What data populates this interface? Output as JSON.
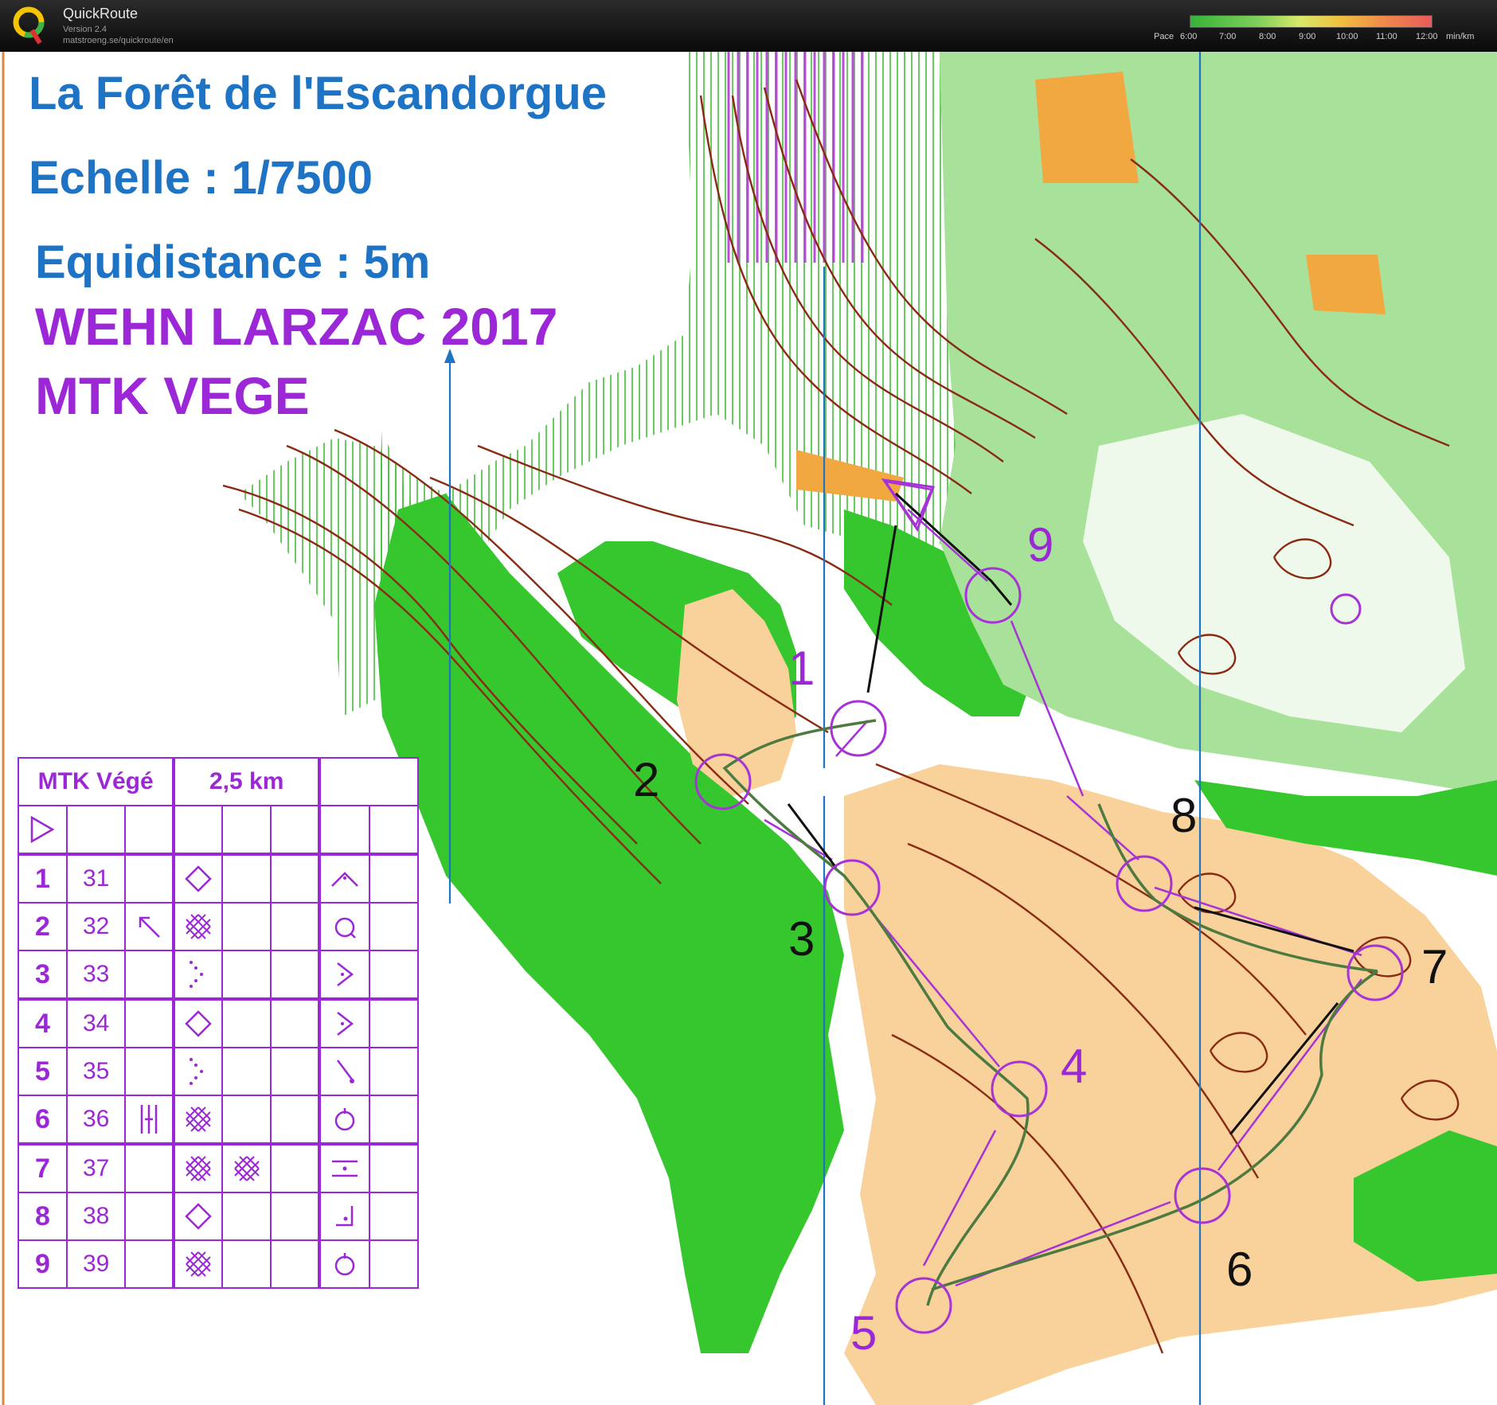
{
  "app": {
    "name": "QuickRoute",
    "version": "Version 2.4",
    "url": "matstroeng.se/quickroute/en",
    "pace": {
      "label": "Pace",
      "ticks": [
        "6:00",
        "7:00",
        "8:00",
        "9:00",
        "10:00",
        "11:00",
        "12:00"
      ],
      "unit": "min/km"
    }
  },
  "map": {
    "title": "La Forêt de l'Escandorgue",
    "scale": "Echelle : 1/7500",
    "contour": "Equidistance : 5m",
    "event": "WEHN LARZAC 2017",
    "course": "MTK VEGE",
    "control_labels": [
      "1",
      "2",
      "3",
      "4",
      "5",
      "6",
      "7",
      "8",
      "9"
    ],
    "colors": {
      "course": "#a732d6",
      "route": "#111111",
      "text_blue": "#1e73c4",
      "vegetation": "#36c72f",
      "open_land": "#f8d29a",
      "contours": "#8a2a12"
    }
  },
  "description": {
    "course": "MTK Végé",
    "length": "2,5 km",
    "rows": [
      {
        "num": "1",
        "code": "31",
        "dir": "",
        "feature": "diamond",
        "extra": "",
        "loc": "top"
      },
      {
        "num": "2",
        "code": "32",
        "dir": "arrow-nw",
        "feature": "cross-hatch",
        "extra": "",
        "loc": "circle"
      },
      {
        "num": "3",
        "code": "33",
        "dir": "",
        "feature": "dots",
        "extra": "",
        "loc": "corner-right"
      },
      {
        "num": "4",
        "code": "34",
        "dir": "",
        "feature": "diamond",
        "extra": "",
        "loc": "corner-right"
      },
      {
        "num": "5",
        "code": "35",
        "dir": "",
        "feature": "dots",
        "extra": "",
        "loc": "end"
      },
      {
        "num": "6",
        "code": "36",
        "dir": "bars",
        "feature": "cross-hatch",
        "extra": "",
        "loc": "circle-top"
      },
      {
        "num": "7",
        "code": "37",
        "dir": "",
        "feature": "cross-hatch",
        "extra": "cross-hatch",
        "loc": "between"
      },
      {
        "num": "8",
        "code": "38",
        "dir": "",
        "feature": "diamond",
        "extra": "",
        "loc": "corner-dot"
      },
      {
        "num": "9",
        "code": "39",
        "dir": "",
        "feature": "cross-hatch",
        "extra": "",
        "loc": "circle-top"
      }
    ]
  }
}
